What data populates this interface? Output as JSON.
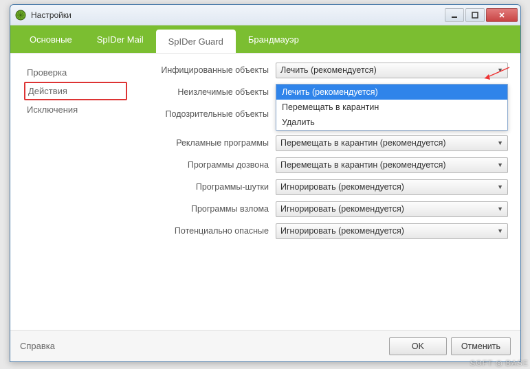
{
  "window": {
    "title": "Настройки"
  },
  "tabs": [
    {
      "label": "Основные"
    },
    {
      "label": "SpIDer Mail"
    },
    {
      "label": "SpIDer Guard"
    },
    {
      "label": "Брандмауэр"
    }
  ],
  "sidebar": {
    "items": [
      {
        "label": "Проверка"
      },
      {
        "label": "Действия"
      },
      {
        "label": "Исключения"
      }
    ]
  },
  "rows": {
    "infected": {
      "label": "Инфицированные объекты",
      "value": "Лечить (рекомендуется)"
    },
    "incurable": {
      "label": "Неизлечимые объекты"
    },
    "suspicious": {
      "label": "Подозрительные объекты"
    },
    "adware": {
      "label": "Рекламные программы",
      "value": "Перемещать в карантин (рекомендуется)"
    },
    "dialers": {
      "label": "Программы дозвона",
      "value": "Перемещать в карантин (рекомендуется)"
    },
    "jokes": {
      "label": "Программы-шутки",
      "value": "Игнорировать (рекомендуется)"
    },
    "hacktools": {
      "label": "Программы взлома",
      "value": "Игнорировать (рекомендуется)"
    },
    "riskware": {
      "label": "Потенциально опасные",
      "value": "Игнорировать (рекомендуется)"
    }
  },
  "dropdown": {
    "options": [
      "Лечить (рекомендуется)",
      "Перемещать в карантин",
      "Удалить"
    ]
  },
  "footer": {
    "help": "Справка",
    "ok": "OK",
    "cancel": "Отменить"
  },
  "watermark": "SOFT ◎ BASE"
}
